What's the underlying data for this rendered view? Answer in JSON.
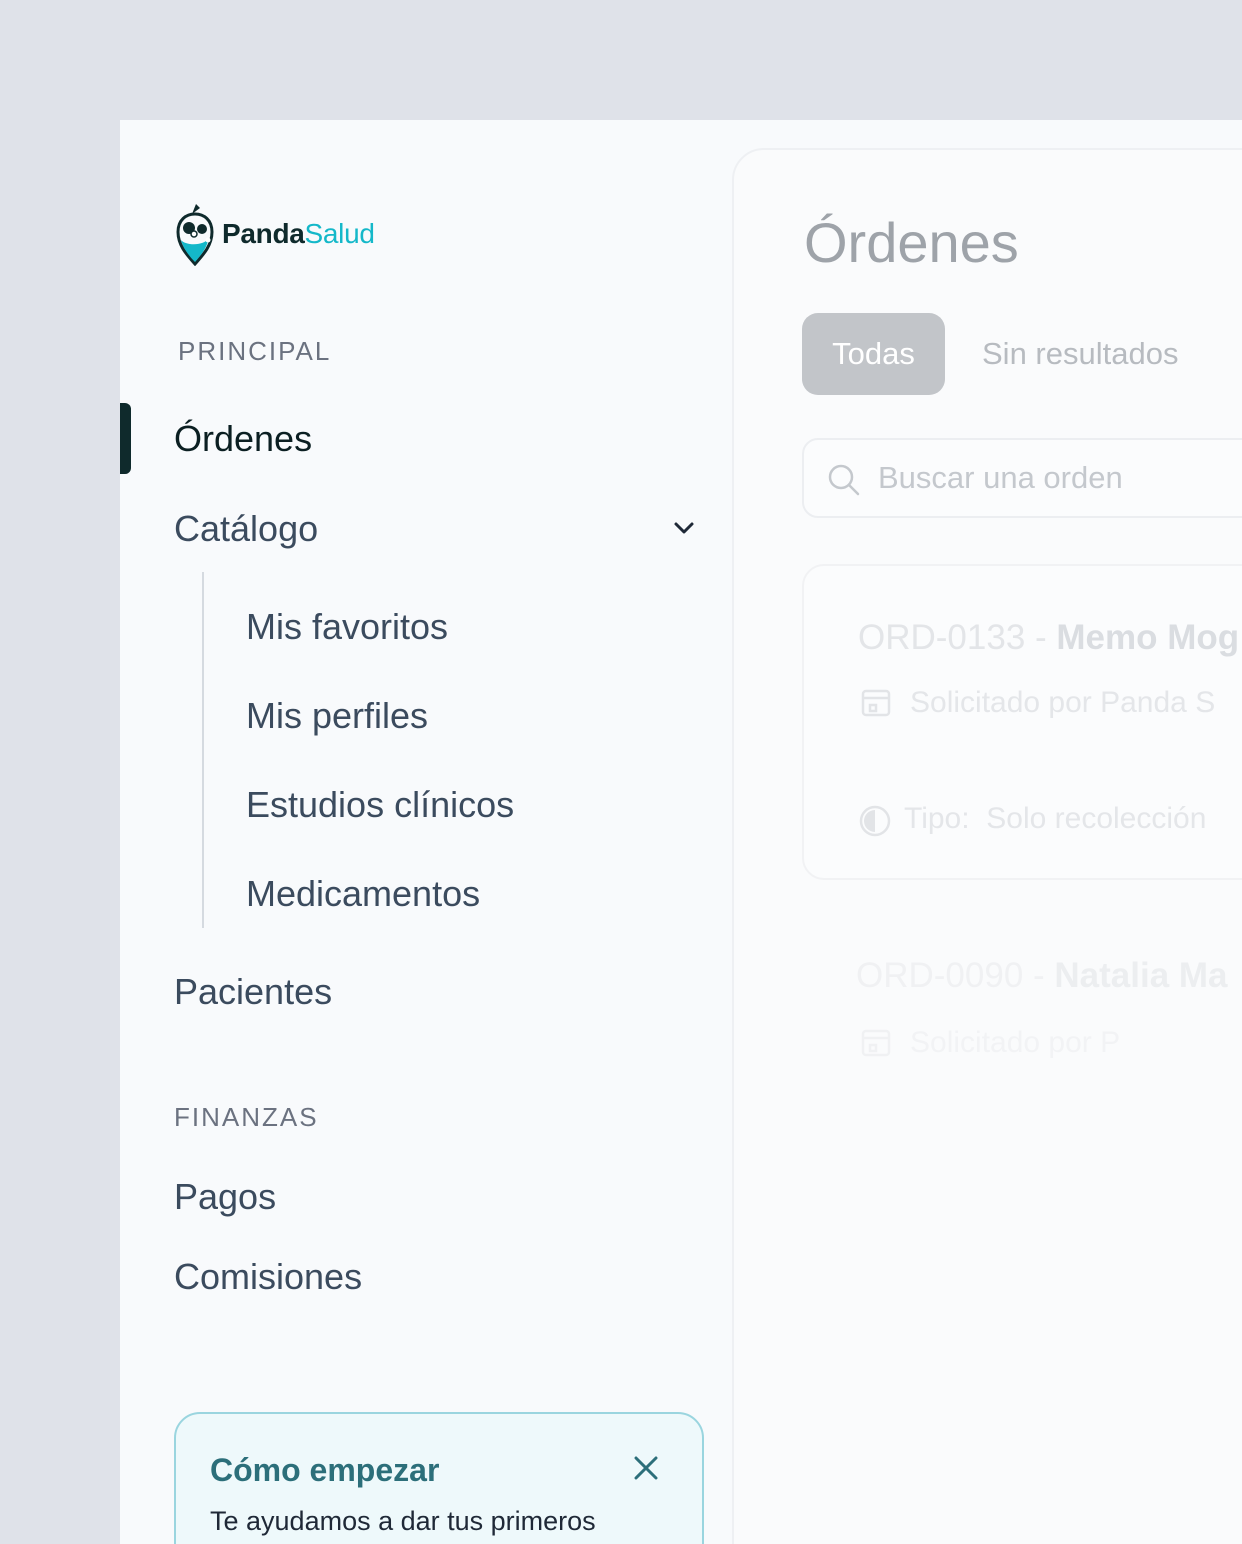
{
  "brand": {
    "name_part1": "Panda",
    "name_part2": "Salud",
    "colors": {
      "dark": "#0f2a2c",
      "accent": "#14b8c9"
    }
  },
  "sidebar": {
    "principal_label": "PRINCIPAL",
    "items": {
      "ordenes": "Órdenes",
      "catalogo": "Catálogo",
      "pacientes": "Pacientes"
    },
    "catalogo_children": {
      "favoritos": "Mis favoritos",
      "perfiles": "Mis perfiles",
      "estudios": "Estudios clínicos",
      "medicamentos": "Medicamentos"
    },
    "finanzas_label": "FINANZAS",
    "finanzas_items": {
      "pagos": "Pagos",
      "comisiones": "Comisiones"
    },
    "active_item": "Órdenes"
  },
  "help_card": {
    "title": "Cómo empezar",
    "body": "Te ayudamos a dar tus primeros"
  },
  "main": {
    "title": "Órdenes",
    "tabs": {
      "all": "Todas",
      "no_results": "Sin resultados"
    },
    "search": {
      "placeholder": "Buscar una orden"
    },
    "orders": [
      {
        "id": "ORD-0133",
        "separator": " - ",
        "patient": "Memo Mog",
        "requested": "Solicitado por Panda S",
        "type_label": "Tipo:",
        "type_value": "Solo recolección"
      },
      {
        "id": "ORD-0090",
        "separator": " - ",
        "patient": "Natalia Ma",
        "requested": "Solicitado por P"
      }
    ]
  }
}
